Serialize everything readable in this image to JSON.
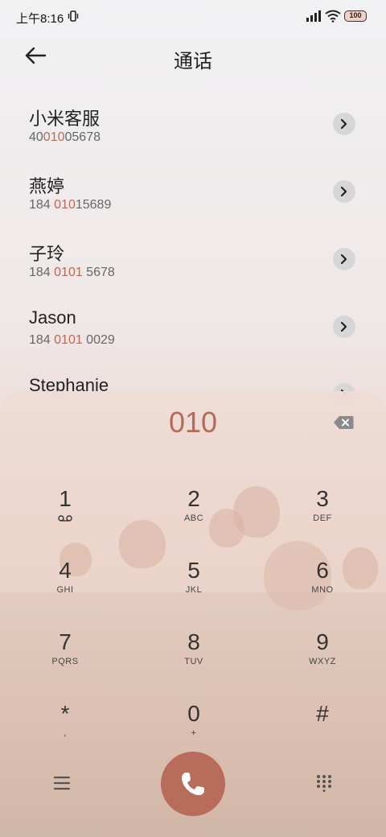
{
  "status": {
    "time": "上午8:16",
    "battery": "100"
  },
  "header": {
    "title": "通话"
  },
  "contacts": [
    {
      "name": "小米客服",
      "num_pre": "40",
      "num_hl": "010",
      "num_post": "05678"
    },
    {
      "name": "燕婷",
      "num_pre": "184 ",
      "num_hl": "010",
      "num_post": "15689"
    },
    {
      "name": "子玲",
      "num_pre": "184 ",
      "num_hl": "0101",
      "num_post": " 5678"
    },
    {
      "name": "Jason",
      "num_pre": "184 ",
      "num_hl": "0101",
      "num_post": " 0029"
    },
    {
      "name": "Stephanie",
      "num_pre": "",
      "num_hl": "",
      "num_post": ""
    }
  ],
  "dialer": {
    "typed": "010",
    "keys": [
      {
        "digit": "1",
        "letters": ""
      },
      {
        "digit": "2",
        "letters": "ABC"
      },
      {
        "digit": "3",
        "letters": "DEF"
      },
      {
        "digit": "4",
        "letters": "GHI"
      },
      {
        "digit": "5",
        "letters": "JKL"
      },
      {
        "digit": "6",
        "letters": "MNO"
      },
      {
        "digit": "7",
        "letters": "PQRS"
      },
      {
        "digit": "8",
        "letters": "TUV"
      },
      {
        "digit": "9",
        "letters": "WXYZ"
      },
      {
        "digit": "*",
        "letters": ","
      },
      {
        "digit": "0",
        "letters": "+"
      },
      {
        "digit": "#",
        "letters": ""
      }
    ]
  },
  "colors": {
    "accent": "#b86d5b",
    "highlight": "#b86a5a"
  }
}
